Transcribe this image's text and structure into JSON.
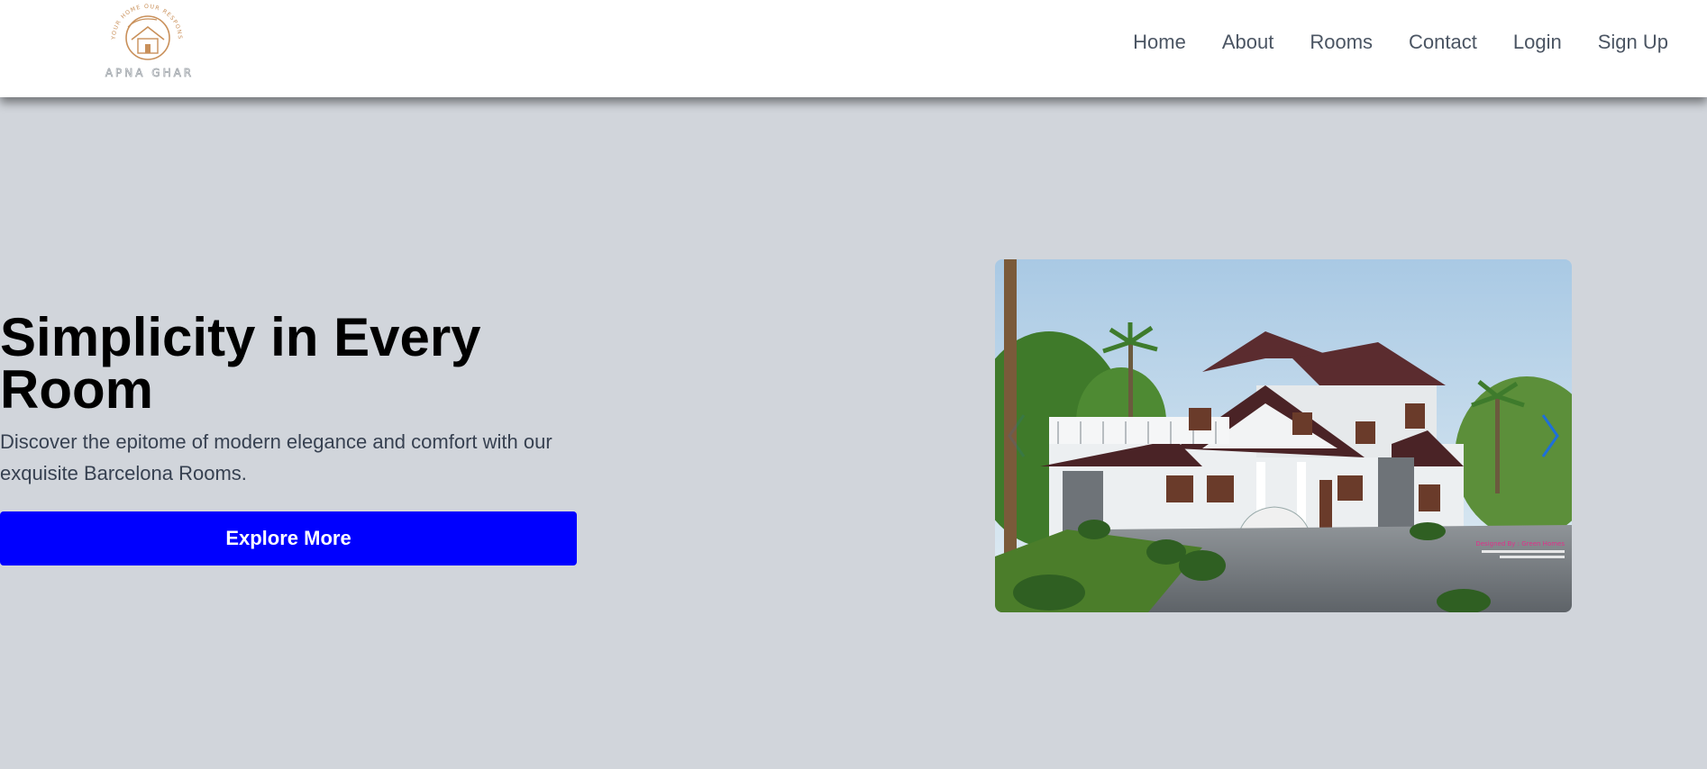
{
  "brand": {
    "name": "APNA GHAR",
    "tagline": "YOUR HOME OUR RESPONSIBILITY"
  },
  "nav": {
    "items": [
      "Home",
      "About",
      "Rooms",
      "Contact",
      "Login",
      "Sign Up"
    ]
  },
  "hero": {
    "title": "Simplicity in Every Room",
    "description": "Discover the epitome of modern elegance and comfort with our exquisite Barcelona Rooms.",
    "cta_label": "Explore More"
  },
  "carousel": {
    "image_caption": "Designed By : Green Homes"
  },
  "colors": {
    "page_bg": "#d1d5db",
    "header_bg": "#ffffff",
    "cta_bg": "#0000ff",
    "nav_text": "#4b5563",
    "logo_accent": "#c9905a",
    "carousel_arrow": "#1e6fd9"
  },
  "icons": {
    "prev": "chevron-left-icon",
    "next": "chevron-right-icon",
    "logo": "house-globe-icon"
  }
}
